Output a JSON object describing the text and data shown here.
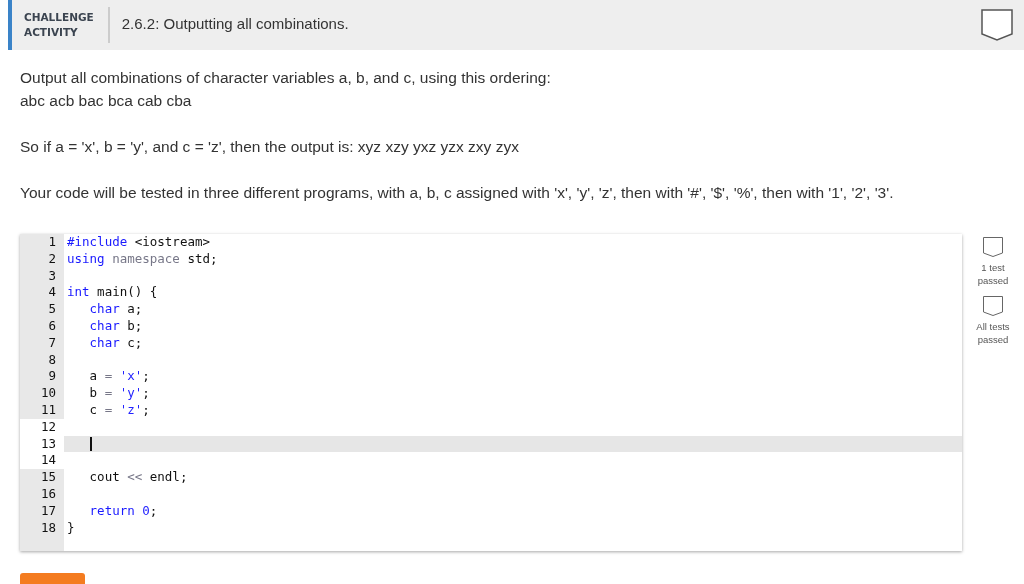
{
  "header": {
    "label_lines": [
      "CHALLENGE",
      "ACTIVITY"
    ],
    "title": "2.6.2: Outputting all combinations.",
    "completed": false
  },
  "instructions": [
    "Output all combinations of character variables a, b, and c, using this ordering:",
    "abc acb bac bca cab cba",
    "So if a = 'x', b = 'y', and c = 'z', then the output is: xyz xzy yxz yzx zxy zyx",
    "Your code will be tested in three different programs, with a, b, c assigned with 'x', 'y', 'z', then with '#', '$', '%', then with '1', '2', '3'."
  ],
  "editor": {
    "lines": [
      {
        "number": "1",
        "readonly": true,
        "current": false,
        "tokens": [
          {
            "text": "#include",
            "kind": "keyword"
          },
          {
            "text": " <iostream>",
            "kind": "plain"
          }
        ]
      },
      {
        "number": "2",
        "readonly": true,
        "current": false,
        "tokens": [
          {
            "text": "using",
            "kind": "keyword"
          },
          {
            "text": " namespace",
            "kind": "muted"
          },
          {
            "text": " std;",
            "kind": "plain"
          }
        ]
      },
      {
        "number": "3",
        "readonly": true,
        "current": false
      },
      {
        "number": "4",
        "readonly": true,
        "current": false,
        "tokens": [
          {
            "text": "int",
            "kind": "keyword"
          },
          {
            "text": " main() {",
            "kind": "plain"
          }
        ]
      },
      {
        "number": "5",
        "readonly": true,
        "current": false,
        "tokens": [
          {
            "text": "   char",
            "kind": "keyword"
          },
          {
            "text": " a;",
            "kind": "plain"
          }
        ]
      },
      {
        "number": "6",
        "readonly": true,
        "current": false,
        "tokens": [
          {
            "text": "   char",
            "kind": "keyword"
          },
          {
            "text": " b;",
            "kind": "plain"
          }
        ]
      },
      {
        "number": "7",
        "readonly": true,
        "current": false,
        "tokens": [
          {
            "text": "   char",
            "kind": "keyword"
          },
          {
            "text": " c;",
            "kind": "plain"
          }
        ]
      },
      {
        "number": "8",
        "readonly": true,
        "current": false
      },
      {
        "number": "9",
        "readonly": true,
        "current": false,
        "tokens": [
          {
            "text": "   a",
            "kind": "plain"
          },
          {
            "text": " = ",
            "kind": "muted"
          },
          {
            "text": "'x'",
            "kind": "string"
          },
          {
            "text": ";",
            "kind": "plain"
          }
        ]
      },
      {
        "number": "10",
        "readonly": true,
        "current": false,
        "tokens": [
          {
            "text": "   b",
            "kind": "plain"
          },
          {
            "text": " = ",
            "kind": "muted"
          },
          {
            "text": "'y'",
            "kind": "string"
          },
          {
            "text": ";",
            "kind": "plain"
          }
        ]
      },
      {
        "number": "11",
        "readonly": true,
        "current": false,
        "tokens": [
          {
            "text": "   c",
            "kind": "plain"
          },
          {
            "text": " = ",
            "kind": "muted"
          },
          {
            "text": "'z'",
            "kind": "string"
          },
          {
            "text": ";",
            "kind": "plain"
          }
        ]
      },
      {
        "number": "12",
        "readonly": false,
        "current": false
      },
      {
        "number": "13",
        "readonly": false,
        "current": true
      },
      {
        "number": "14",
        "readonly": false,
        "current": false
      },
      {
        "number": "15",
        "readonly": true,
        "current": false,
        "tokens": [
          {
            "text": "   cout",
            "kind": "plain"
          },
          {
            "text": " << ",
            "kind": "muted"
          },
          {
            "text": "endl;",
            "kind": "plain"
          }
        ]
      },
      {
        "number": "16",
        "readonly": true,
        "current": false
      },
      {
        "number": "17",
        "readonly": true,
        "current": false,
        "tokens": [
          {
            "text": "   return",
            "kind": "keyword"
          },
          {
            "text": " 0",
            "kind": "string"
          },
          {
            "text": ";",
            "kind": "plain"
          }
        ]
      },
      {
        "number": "18",
        "readonly": true,
        "current": false,
        "tokens": [
          {
            "text": "}",
            "kind": "plain"
          }
        ]
      }
    ]
  },
  "tests": [
    {
      "label_lines": [
        "1 test",
        "passed"
      ],
      "passed": false
    },
    {
      "label_lines": [
        "All tests",
        "passed"
      ],
      "passed": false
    }
  ]
}
